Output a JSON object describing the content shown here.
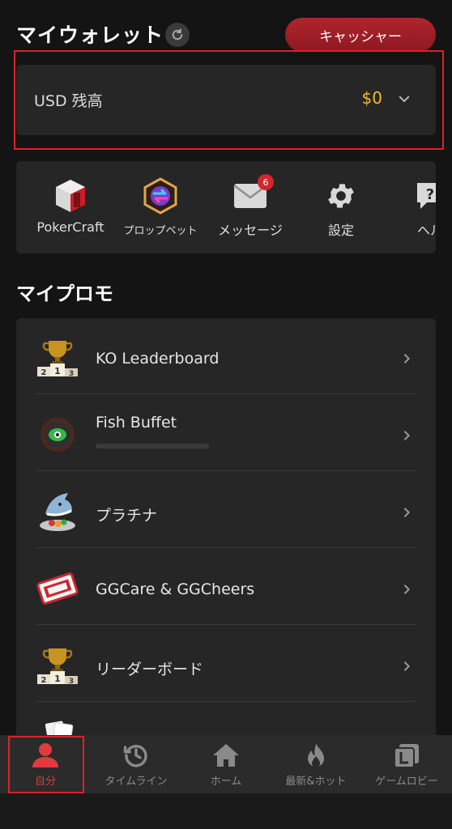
{
  "wallet": {
    "title": "マイウォレット",
    "cashier_label": "キャッシャー"
  },
  "balance": {
    "label": "USD 残高",
    "amount": "$0",
    "amount_color": "#f2bb33"
  },
  "quick_menu": [
    {
      "label": "PokerCraft",
      "icon": "pokercraft-icon"
    },
    {
      "label": "プロップベット",
      "icon": "prop-bet-icon"
    },
    {
      "label": "メッセージ",
      "icon": "envelope-icon",
      "badge": "6"
    },
    {
      "label": "設定",
      "icon": "gear-icon"
    },
    {
      "label": "ヘル",
      "icon": "help-icon"
    }
  ],
  "promo": {
    "title": "マイプロモ",
    "items": [
      {
        "label": "KO Leaderboard",
        "icon": "trophy-podium-icon"
      },
      {
        "label": "Fish Buffet",
        "icon": "fish-plate-icon"
      },
      {
        "label": "プラチナ",
        "icon": "shark-icon"
      },
      {
        "label": "GGCare & GGCheers",
        "icon": "thanks-gg-icon"
      },
      {
        "label": "リーダーボード",
        "icon": "trophy-podium-icon"
      }
    ]
  },
  "nav": {
    "items": [
      {
        "label": "自分",
        "icon": "person-icon",
        "active": true
      },
      {
        "label": "タイムライン",
        "icon": "clock-history-icon"
      },
      {
        "label": "ホーム",
        "icon": "home-icon"
      },
      {
        "label": "最新&ホット",
        "icon": "flame-icon"
      },
      {
        "label": "ゲームロビー",
        "icon": "lobby-icon"
      }
    ],
    "active_color": "#e33a3e"
  }
}
